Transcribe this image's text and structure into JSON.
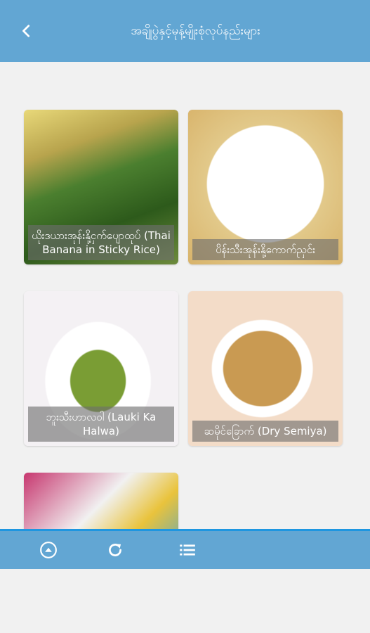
{
  "header": {
    "title": "အချိုပွဲနှင့်မုန့်မျိုးစုံလုပ်နည်းများ",
    "back_icon": "chevron-left-icon"
  },
  "recipes": [
    {
      "caption": "ယိုးဒယားအုန်းနို့ငှက်ပျောထုပ် (Thai Banana in Sticky Rice)"
    },
    {
      "caption": "ပိန်းသီးအုန်းနို့ကောက်ညှင်း"
    },
    {
      "caption": "ဘူးသီးဟာလဝါ (Lauki Ka Halwa)"
    },
    {
      "caption": "ဆမိုင်ခြောက် (Dry Semiya)"
    },
    {
      "caption": ""
    }
  ],
  "bottom_bar": {
    "icons": [
      "arrow-up-circle-icon",
      "refresh-icon",
      "list-menu-icon"
    ]
  },
  "colors": {
    "app_bar": "#62a6d3",
    "accent_line": "#1e96e0",
    "background": "#f1f1f1"
  }
}
